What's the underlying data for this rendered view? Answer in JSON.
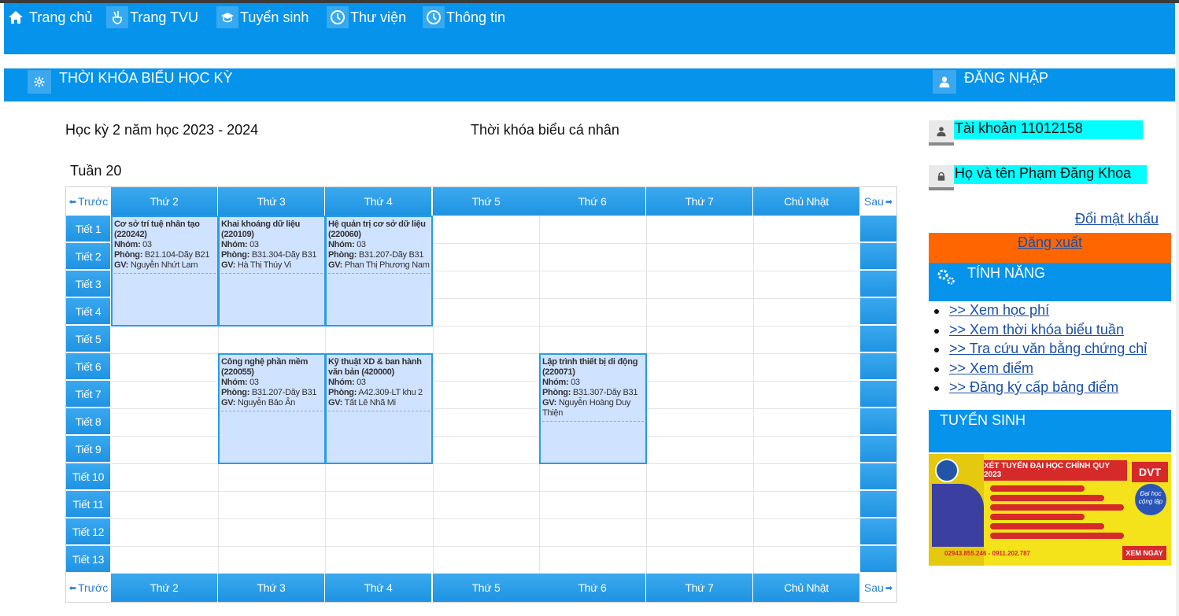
{
  "nav": {
    "items": [
      {
        "label": "Trang chủ",
        "icon": "home-icon"
      },
      {
        "label": "Trang TVU",
        "icon": "hand-icon"
      },
      {
        "label": "Tuyển sinh",
        "icon": "graduation-icon"
      },
      {
        "label": "Thư viện",
        "icon": "clock-icon"
      },
      {
        "label": "Thông tin",
        "icon": "clock-icon"
      }
    ]
  },
  "main": {
    "title": "THỜI KHÓA BIỂU HỌC KỲ",
    "semester": "Học kỳ 2 năm học 2023 - 2024",
    "tkb_title": "Thời khóa biểu cá nhân",
    "week": "Tuần 20",
    "prev": "Trước",
    "next": "Sau",
    "days": [
      "Thứ 2",
      "Thứ 3",
      "Thứ 4",
      "Thứ 5",
      "Thứ 6",
      "Thứ 7",
      "Chủ Nhật"
    ],
    "periods": [
      "Tiết 1",
      "Tiết 2",
      "Tiết 3",
      "Tiết 4",
      "Tiết 5",
      "Tiết 6",
      "Tiết 7",
      "Tiết 8",
      "Tiết 9",
      "Tiết 10",
      "Tiết 11",
      "Tiết 12",
      "Tiết 13"
    ],
    "labels": {
      "group": "Nhóm:",
      "room": "Phòng:",
      "teacher": "GV:"
    },
    "courses": [
      {
        "day": 0,
        "start": 1,
        "span": 4,
        "name": "Cơ sở trí tuệ nhân tạo (220242)",
        "group": "03",
        "room": "B21.104-Dãy B21",
        "teacher": "Nguyễn Nhứt Lam"
      },
      {
        "day": 1,
        "start": 1,
        "span": 4,
        "name": "Khai khoáng dữ liệu (220109)",
        "group": "03",
        "room": "B31.304-Dãy B31",
        "teacher": "Hà Thị Thúy Vi"
      },
      {
        "day": 2,
        "start": 1,
        "span": 4,
        "name": "Hệ quản trị cơ sở dữ liệu (220060)",
        "group": "03",
        "room": "B31.207-Dãy B31",
        "teacher": "Phan Thị Phương Nam"
      },
      {
        "day": 1,
        "start": 6,
        "span": 4,
        "name": "Công nghệ phần mềm (220055)",
        "group": "03",
        "room": "B31.207-Dãy B31",
        "teacher": "Nguyễn Bảo Ân"
      },
      {
        "day": 2,
        "start": 6,
        "span": 4,
        "name": "Kỹ thuật XD & ban hành văn bản (420000)",
        "group": "03",
        "room": "A42.309-LT khu 2",
        "teacher": "Tất Lê Nhã Mi"
      },
      {
        "day": 4,
        "start": 6,
        "span": 4,
        "name": "Lập trình thiết bị di động (220071)",
        "group": "03",
        "room": "B31.307-Dãy B31",
        "teacher": "Nguyễn Hoàng Duy Thiện"
      }
    ]
  },
  "sidebar": {
    "login_title": "ĐĂNG NHẬP",
    "account_label": "Tài khoản 11012158",
    "name_label": "Họ và tên Phạm Đăng Khoa",
    "change_password": "Đổi mật khẩu",
    "logout": "Đăng xuất",
    "features_title": "TÍNH NĂNG",
    "features": [
      ">> Xem học phí",
      ">> Xem thời khóa biểu tuần",
      ">> Tra cứu văn bằng chứng chỉ",
      ">> Xem điểm",
      ">> Đăng ký cấp bảng điểm"
    ],
    "admissions_title": "TUYỂN SINH",
    "banner": {
      "headline": "XÉT TUYỂN ĐẠI HỌC CHÍNH QUY 2023",
      "badge": "DVT",
      "slogan": "Đại học cộng lập",
      "phone": "02943.855.246 - 0911.202.787",
      "cta": "XEM NGAY"
    }
  },
  "colors": {
    "primary": "#0693ec",
    "logout": "#ff6600",
    "highlight": "#00ffff",
    "course_bg": "#cfe2ff"
  }
}
